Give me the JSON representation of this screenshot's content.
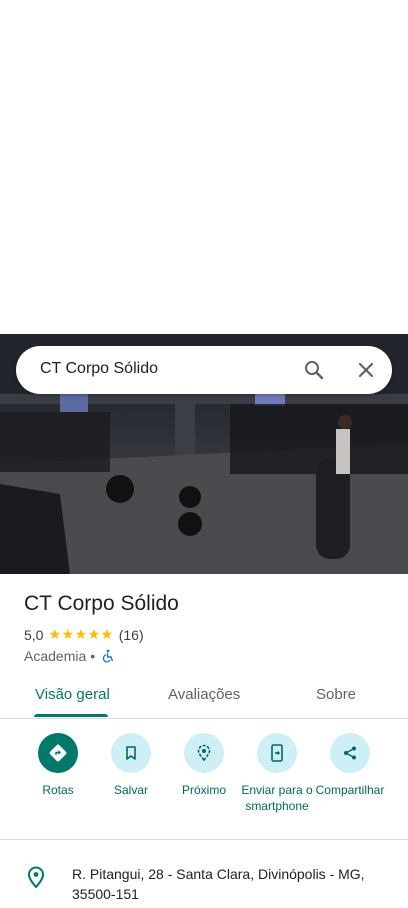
{
  "search": {
    "query": "CT Corpo Sólido"
  },
  "place": {
    "title": "CT Corpo Sólido",
    "rating": "5,0",
    "stars": "★★★★★",
    "reviews_count": "(16)",
    "category": "Academia",
    "separator": "•"
  },
  "tabs": [
    {
      "label": "Visão geral",
      "active": true
    },
    {
      "label": "Avaliações",
      "active": false
    },
    {
      "label": "Sobre",
      "active": false
    }
  ],
  "actions": [
    {
      "label": "Rotas",
      "icon": "directions-icon"
    },
    {
      "label": "Salvar",
      "icon": "bookmark-icon"
    },
    {
      "label": "Próximo",
      "icon": "nearby-icon"
    },
    {
      "label": "Enviar para o smartphone",
      "icon": "send-to-phone-icon"
    },
    {
      "label": "Compartilhar",
      "icon": "share-icon"
    }
  ],
  "address": {
    "text": "R. Pitangui, 28 - Santa Clara, Divinópolis - MG, 35500-151"
  },
  "colors": {
    "accent": "#00796b",
    "action_bg": "#cfeff6",
    "star": "#fbbc04"
  }
}
